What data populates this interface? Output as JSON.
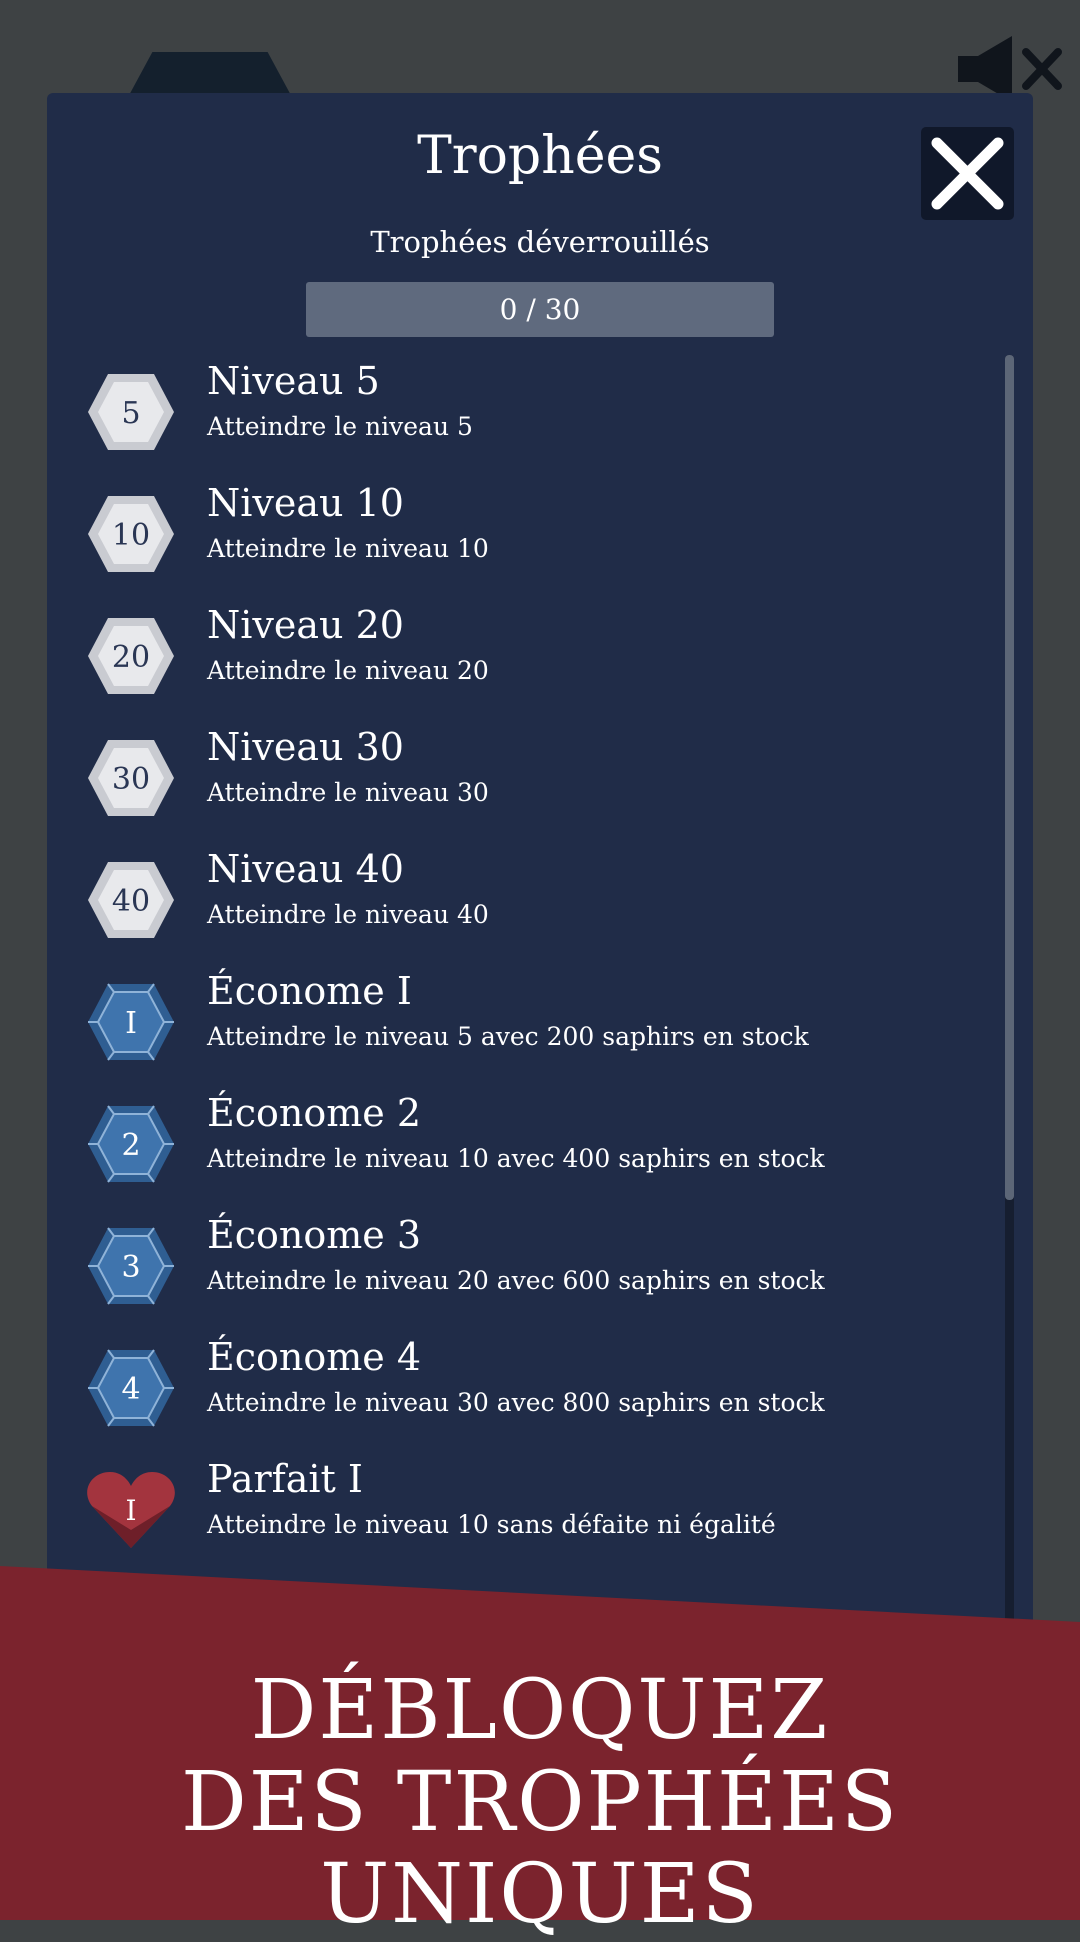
{
  "header": {
    "title": "Trophées",
    "subtitle": "Trophées déverrouillés",
    "progress": "0 / 30"
  },
  "trophies": [
    {
      "badge": "5",
      "badge_type": "silver-hexagon",
      "title": "Niveau 5",
      "desc": "Atteindre le niveau 5"
    },
    {
      "badge": "10",
      "badge_type": "silver-hexagon",
      "title": "Niveau 10",
      "desc": "Atteindre le niveau 10"
    },
    {
      "badge": "20",
      "badge_type": "silver-hexagon",
      "title": "Niveau 20",
      "desc": "Atteindre le niveau 20"
    },
    {
      "badge": "30",
      "badge_type": "silver-hexagon",
      "title": "Niveau 30",
      "desc": "Atteindre le niveau 30"
    },
    {
      "badge": "40",
      "badge_type": "silver-hexagon",
      "title": "Niveau 40",
      "desc": "Atteindre le niveau 40"
    },
    {
      "badge": "I",
      "badge_type": "sapphire-hexagon",
      "title": "Économe I",
      "desc": "Atteindre le niveau 5 avec 200 saphirs en stock"
    },
    {
      "badge": "2",
      "badge_type": "sapphire-hexagon",
      "title": "Économe 2",
      "desc": "Atteindre le niveau 10 avec 400 saphirs en stock"
    },
    {
      "badge": "3",
      "badge_type": "sapphire-hexagon",
      "title": "Économe 3",
      "desc": "Atteindre le niveau 20 avec 600 saphirs en stock"
    },
    {
      "badge": "4",
      "badge_type": "sapphire-hexagon",
      "title": "Économe 4",
      "desc": "Atteindre le niveau 30 avec 800 saphirs en stock"
    },
    {
      "badge": "I",
      "badge_type": "ruby-heart",
      "title": "Parfait I",
      "desc": "Atteindre le niveau 10 sans défaite ni égalité"
    }
  ],
  "banner": {
    "line1": "DÉBLOQUEZ",
    "line2": "DES TROPHÉES UNIQUES"
  },
  "icons": {
    "sound": "speaker-muted-icon",
    "close": "close-icon"
  },
  "colors": {
    "panel": "#202c48",
    "progress_bar": "#5f6a7e",
    "banner": "#7b232d",
    "silver_badge": "#e8e9ec",
    "sapphire_badge": "#3f74ad",
    "ruby_badge": "#a3343e"
  }
}
